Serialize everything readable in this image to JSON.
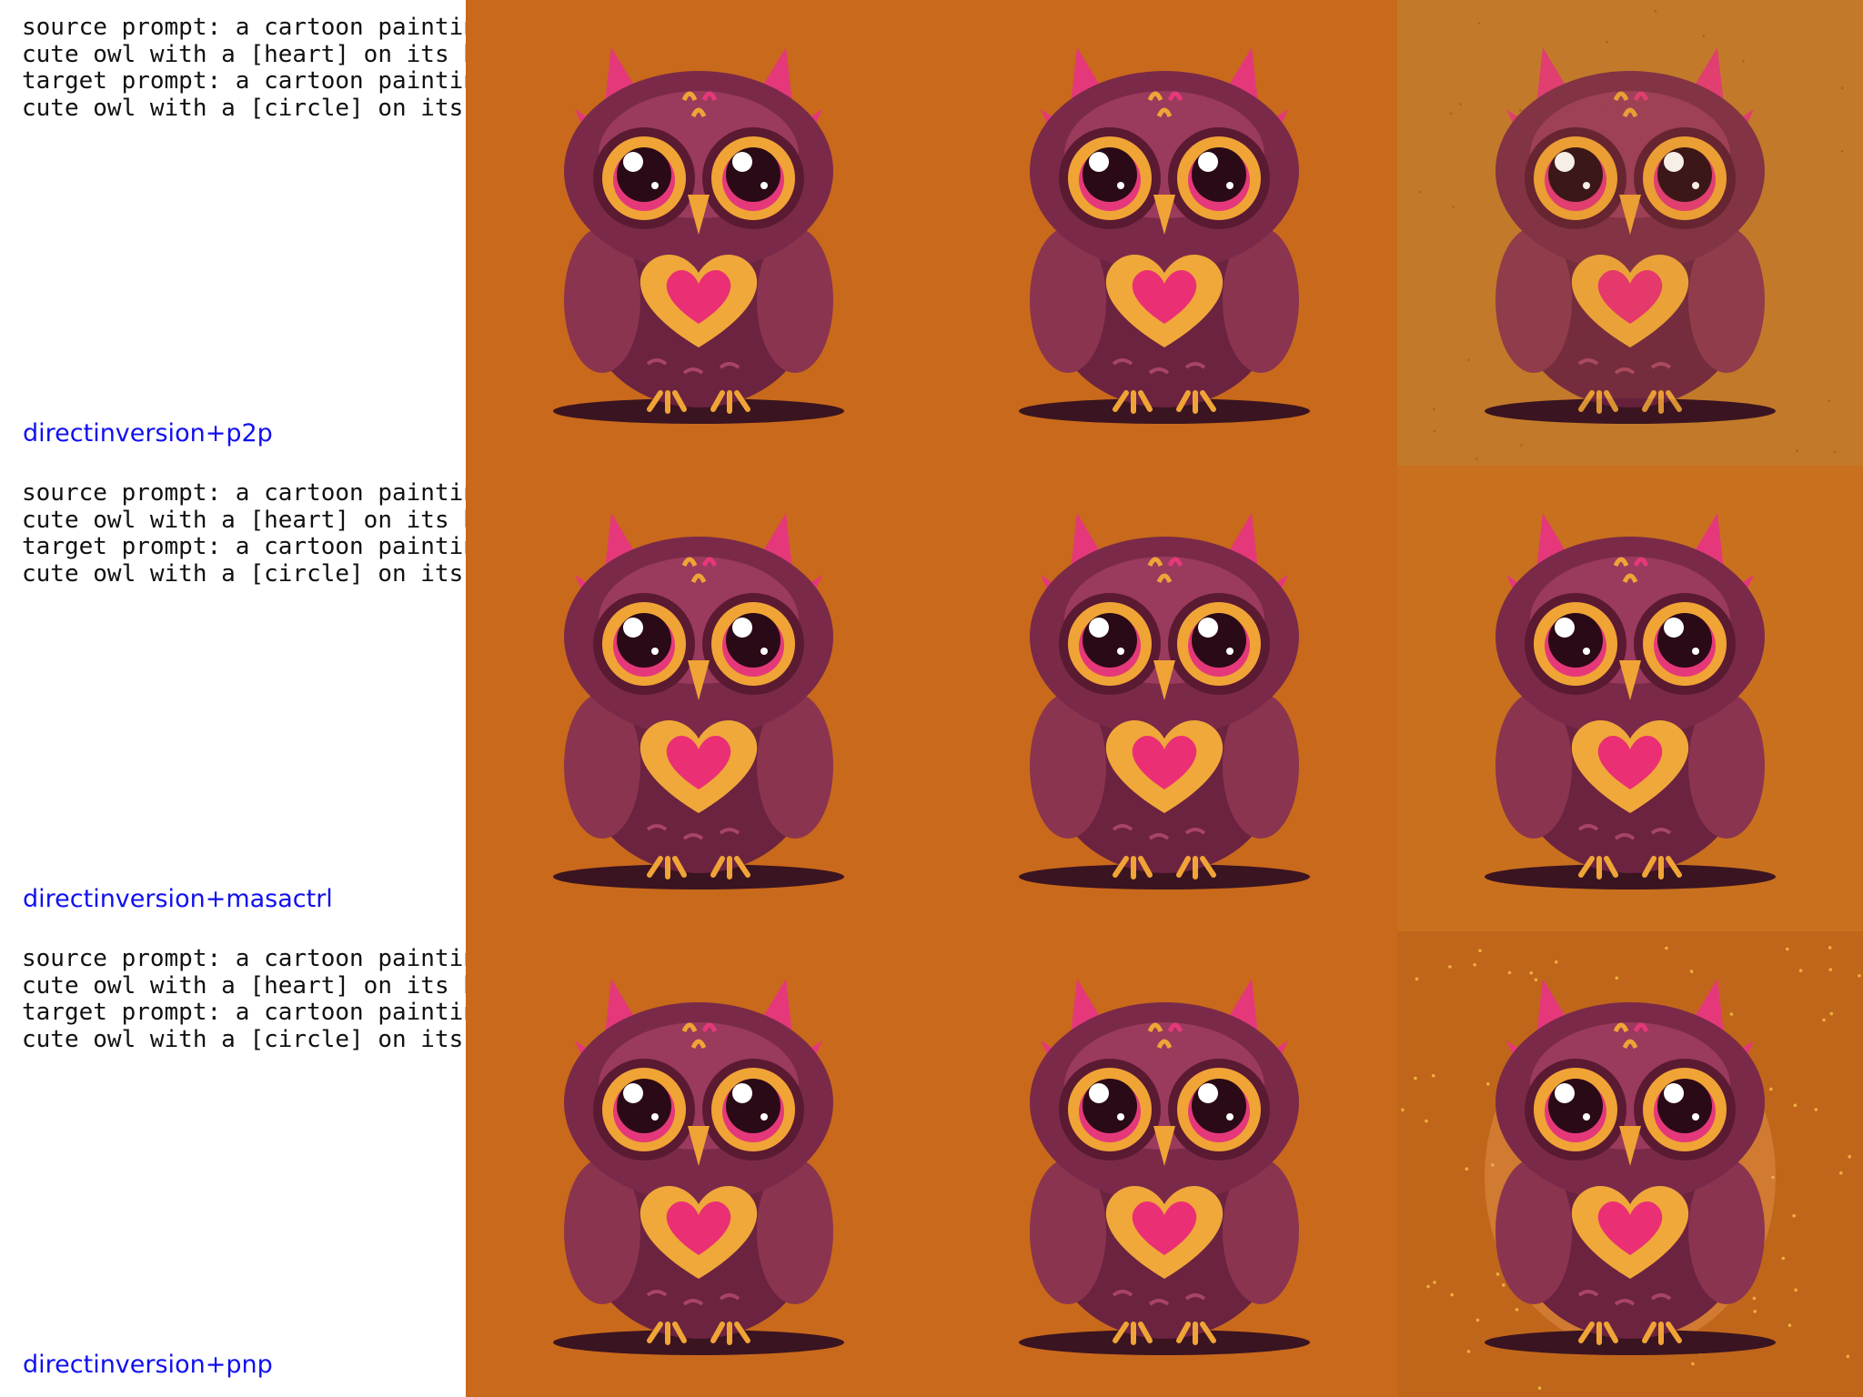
{
  "rows": [
    {
      "prompt": "source prompt: a cartoon painting of a\ncute owl with a [heart] on its body\ntarget prompt: a cartoon painting of a\ncute owl with a [circle] on its body",
      "method": "directinversion+p2p",
      "panels": [
        {
          "bg": "#c9691c",
          "variant": "plain"
        },
        {
          "bg": "#c9691c",
          "variant": "plain"
        },
        {
          "bg": "#c27a2a",
          "variant": "speckled"
        }
      ]
    },
    {
      "prompt": "source prompt: a cartoon painting of a\ncute owl with a [heart] on its body\ntarget prompt: a cartoon painting of a\ncute owl with a [circle] on its body",
      "method": "directinversion+masactrl",
      "panels": [
        {
          "bg": "#c9691c",
          "variant": "plain"
        },
        {
          "bg": "#c9691c",
          "variant": "plain"
        },
        {
          "bg": "#c9701f",
          "variant": "plain"
        }
      ]
    },
    {
      "prompt": "source prompt: a cartoon painting of a\ncute owl with a [heart] on its body\ntarget prompt: a cartoon painting of a\ncute owl with a [circle] on its body",
      "method": "directinversion+pnp",
      "panels": [
        {
          "bg": "#c9691c",
          "variant": "plain"
        },
        {
          "bg": "#c9691c",
          "variant": "plain"
        },
        {
          "bg": "#c0661a",
          "variant": "sparkle"
        }
      ]
    }
  ],
  "colors": {
    "method_text": "#1010ee",
    "owl_body": "#6b2340",
    "owl_pink": "#e5387a",
    "eye_ring": "#f0a436",
    "heart_outer": "#f0a83a",
    "heart_inner": "#ea2f74"
  }
}
